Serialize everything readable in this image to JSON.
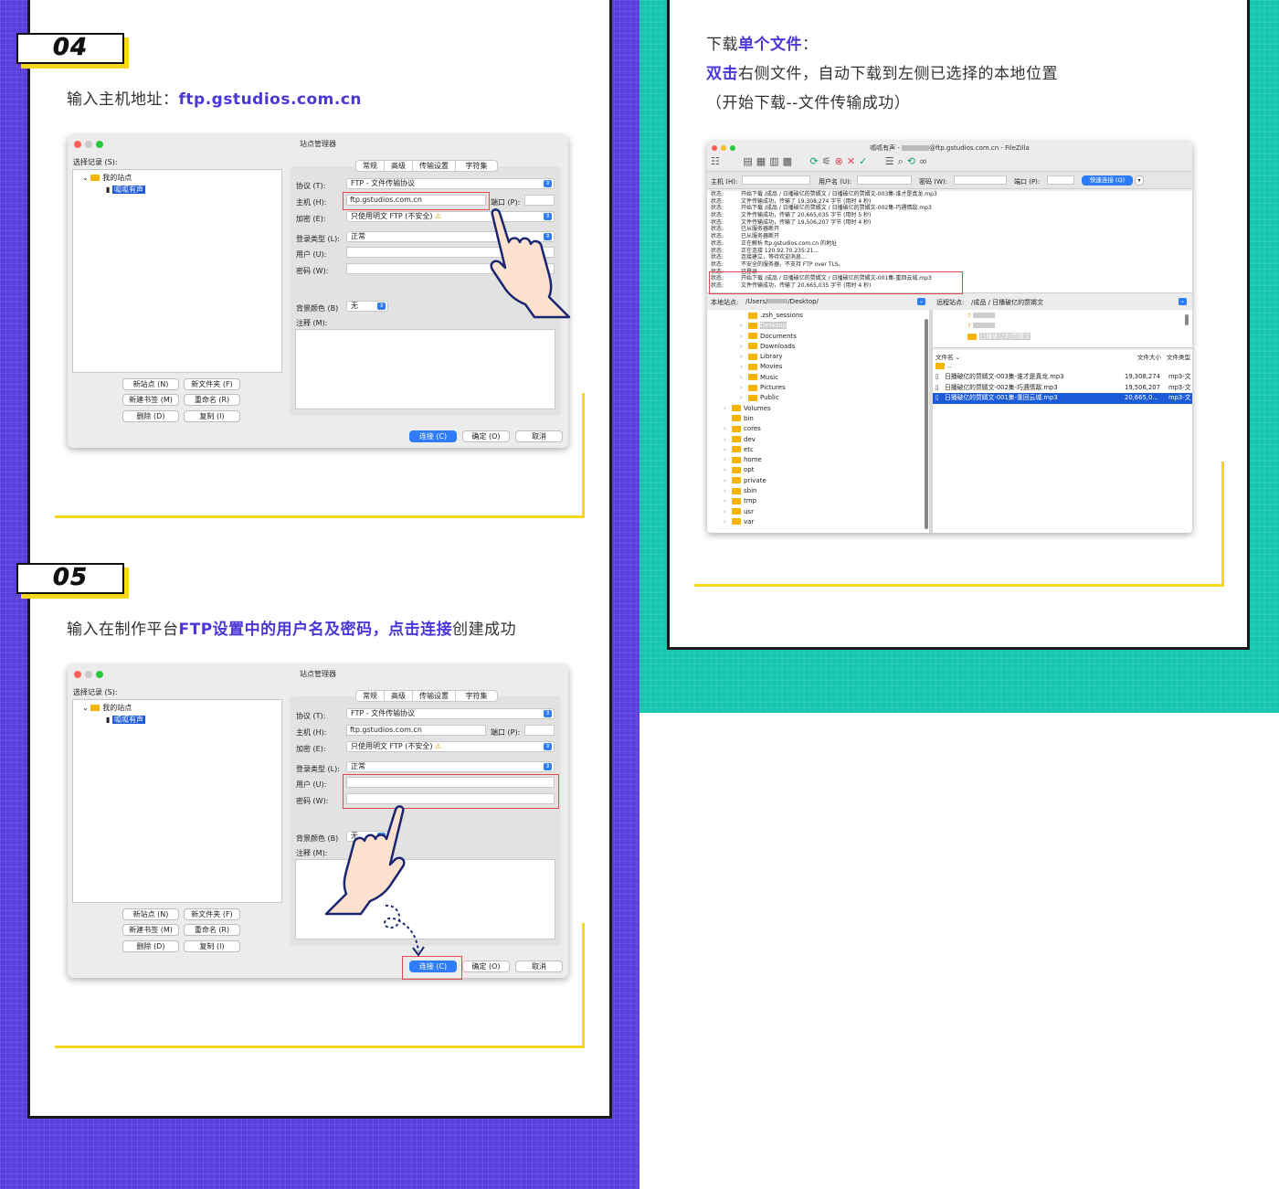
{
  "step4": {
    "badge": "04",
    "text_prefix": "输入主机地址：",
    "text_link": "ftp.gstudios.com.cn"
  },
  "step5": {
    "badge": "05",
    "text_a": "输入在制作平台",
    "text_b": "FTP设置中的用户名及密码，点击连接",
    "text_c": "创建成功"
  },
  "right_text": {
    "line1_a": "下载",
    "line1_b": "单个文件",
    "line1_c": "：",
    "line2_a": "双击",
    "line2_b": "右侧文件，自动下载到左侧已选择的本地位置",
    "line3": "（开始下载--文件传输成功）"
  },
  "site_manager": {
    "title": "站点管理器",
    "select_record": "选择记录 (S):",
    "tree_root": "我的站点",
    "tree_site": "呱呱有声",
    "tabs": [
      "常规",
      "高级",
      "传输设置",
      "字符集"
    ],
    "protocol_label": "协议 (T):",
    "protocol_value": "FTP - 文件传输协议",
    "host_label": "主机 (H):",
    "host_value": "ftp.gstudios.com.cn",
    "port_label": "端口 (P):",
    "encrypt_label": "加密 (E):",
    "encrypt_value": "只使用明文 FTP (不安全)",
    "logon_label": "登录类型 (L):",
    "logon_value": "正常",
    "user_label": "用户 (U):",
    "pass_label": "密码 (W):",
    "bg_label": "背景颜色 (B)",
    "bg_value": "无",
    "comment_label": "注释 (M):",
    "btn_new_site": "新站点 (N)",
    "btn_new_folder": "新文件夹 (F)",
    "btn_new_bookmark": "新建书签 (M)",
    "btn_rename": "重命名 (R)",
    "btn_delete": "删除 (D)",
    "btn_copy": "复制 (I)",
    "btn_connect": "连接 (C)",
    "btn_ok": "确定 (O)",
    "btn_cancel": "取消"
  },
  "filezilla": {
    "title_a": "呱呱有声 - ",
    "title_b": "@ftp.gstudios.com.cn - FileZilla",
    "host_label": "主机 (H):",
    "user_label": "用户名 (U):",
    "pass_label": "密码 (W):",
    "port_label": "端口 (P):",
    "quick_connect": "快速连接 (Q)",
    "log": [
      {
        "s": "状态:",
        "m": "开始下载 /成品 / 日播破亿的赘婿文 / 日播破亿的赘婿文-003集-谁才是真龙.mp3"
      },
      {
        "s": "状态:",
        "m": "文件传输成功，传输了 19,308,274 字节 (用时 4 秒)"
      },
      {
        "s": "状态:",
        "m": "开始下载 /成品 / 日播破亿的赘婿文 / 日播破亿的赘婿文-002集-巧遇情敌.mp3"
      },
      {
        "s": "状态:",
        "m": "文件传输成功，传输了 20,665,035 字节 (用时 5 秒)"
      },
      {
        "s": "状态:",
        "m": "文件传输成功，传输了 19,506,207 字节 (用时 4 秒)"
      },
      {
        "s": "状态:",
        "m": "已从服务器断开"
      },
      {
        "s": "状态:",
        "m": "已从服务器断开"
      },
      {
        "s": "状态:",
        "m": "正在解析 ftp.gstudios.com.cn 的地址"
      },
      {
        "s": "状态:",
        "m": "正在连接 120.92.70.235:21..."
      },
      {
        "s": "状态:",
        "m": "连接建立，等待欢迎消息..."
      },
      {
        "s": "状态:",
        "m": "不安全的服务器，不支持 FTP over TLS。"
      },
      {
        "s": "状态:",
        "m": "已登录"
      },
      {
        "s": "状态:",
        "m": "开始下载 /成品 / 日播破亿的赘婿文 / 日播破亿的赘婿文-001集-重回云城.mp3"
      },
      {
        "s": "状态:",
        "m": "文件传输成功，传输了 20,665,035 字节 (用时 4 秒)"
      }
    ],
    "local_label": "本地站点:",
    "local_path_a": "/Users/",
    "local_path_b": "/Desktop/",
    "remote_label": "远程站点:",
    "remote_path": "/成品 / 日播破亿的赘婿文",
    "local_tree": [
      ".zsh_sessions",
      "Desktop",
      "Documents",
      "Downloads",
      "Library",
      "Movies",
      "Music",
      "Pictures",
      "Public",
      "Volumes",
      "bin",
      "cores",
      "dev",
      "etc",
      "home",
      "opt",
      "private",
      "sbin",
      "tmp",
      "usr",
      "var"
    ],
    "remote_tree_last": "日播破亿的赘婿文",
    "col_name": "文件名",
    "col_size": "文件大小",
    "col_type": "文件类型",
    "files": [
      {
        "name": "..",
        "size": "",
        "type": ""
      },
      {
        "name": "日播破亿的赘婿文-003集-谁才是真龙.mp3",
        "size": "19,308,274",
        "type": "mp3-文"
      },
      {
        "name": "日播破亿的赘婿文-002集-巧遇情敌.mp3",
        "size": "19,506,207",
        "type": "mp3-文"
      },
      {
        "name": "日播破亿的赘婿文-001集-重回云城.mp3",
        "size": "20,665,0...",
        "type": "mp3-文"
      }
    ]
  },
  "colors": {
    "purple": "#5a3ee0",
    "teal": "#16c6b0",
    "yellow": "#f7d71c",
    "highlight": "#4b36d9"
  }
}
